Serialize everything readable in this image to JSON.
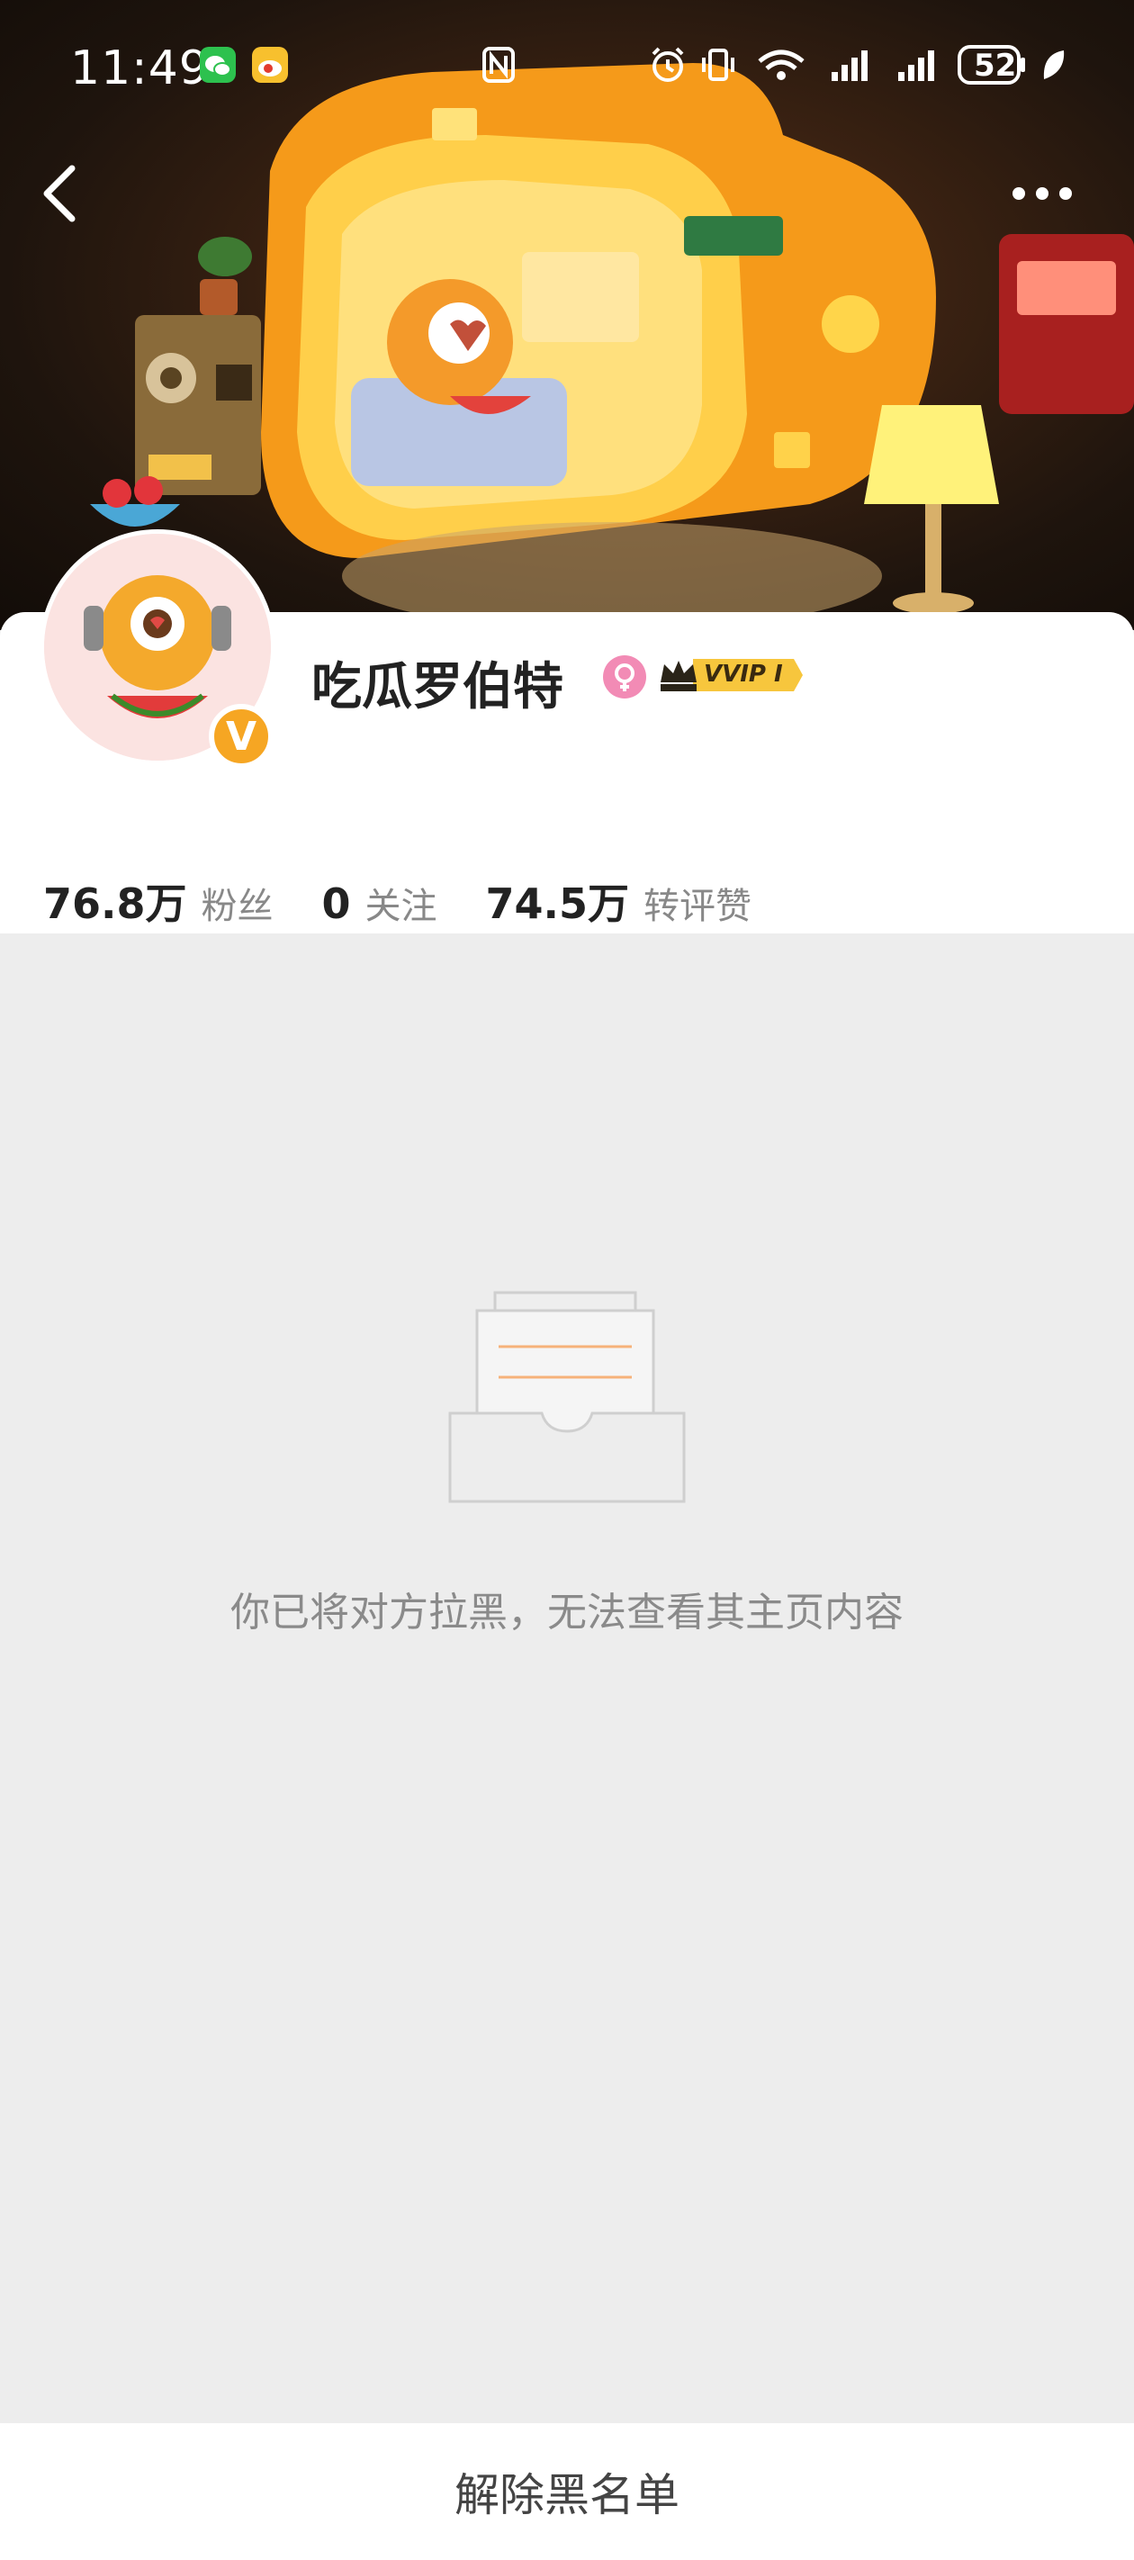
{
  "status_bar": {
    "time": "11:49",
    "battery": "52"
  },
  "profile": {
    "username": "吃瓜罗伯特",
    "vip_badge": "VVIP I",
    "verified_mark": "V",
    "gender_icon": "female-icon"
  },
  "stats": [
    {
      "value": "76.8万",
      "label": "粉丝"
    },
    {
      "value": "0",
      "label": "关注"
    },
    {
      "value": "74.5万",
      "label": "转评赞"
    }
  ],
  "empty_state": {
    "message": "你已将对方拉黑，无法查看其主页内容"
  },
  "bottom": {
    "unblock_label": "解除黑名单"
  },
  "colors": {
    "accent_orange": "#f6a623",
    "page_bg": "#ededed",
    "female_pink": "#f28bb5"
  }
}
